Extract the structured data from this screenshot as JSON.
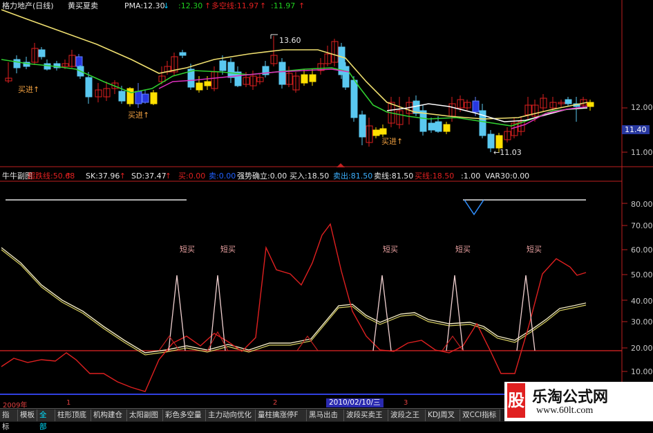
{
  "header": {
    "stock": "格力地产(日线)",
    "formula": "黄买夏卖",
    "pma": "PMA:12.30",
    "pma_arrow": "↓",
    "v2": ":12.30",
    "v2_arrow": "↑",
    "duokong": "多空线:11.97",
    "duokong_arrow": "↑",
    "v4": ":11.97",
    "v4_arrow": "↑"
  },
  "main": {
    "price_labels": [
      "12.00",
      "11.40",
      "11.00"
    ],
    "high_label": "13.60",
    "low_label": "←11.03",
    "buy_labels": [
      "买进",
      "买进",
      "买进"
    ]
  },
  "sub": {
    "title": "牛牛副图",
    "items": [
      {
        "text": "超跌线:50.68",
        "color": "#e02020",
        "arrow": "↑"
      },
      {
        "text": "SK:37.96",
        "color": "#e8e8e8",
        "arrow": "↑"
      },
      {
        "text": "SD:37.47",
        "color": "#e8e8e8",
        "arrow": "↑"
      },
      {
        "text": "买:0.00",
        "color": "#e02020",
        "arrow": ""
      },
      {
        "text": "卖:0.00",
        "color": "#2060ff",
        "arrow": ""
      },
      {
        "text": "强势确立:0.00",
        "color": "#e8e8e8",
        "arrow": ""
      },
      {
        "text": "买入:18.50",
        "color": "#e8e8e8",
        "arrow": ""
      },
      {
        "text": "卖出:81.50",
        "color": "#3cb0ff",
        "arrow": ""
      },
      {
        "text": "卖线:81.50",
        "color": "#e8e8e8",
        "arrow": ""
      },
      {
        "text": "买线:18.50",
        "color": "#e02020",
        "arrow": ""
      },
      {
        "text": ":1.00",
        "color": "#e8e8e8",
        "arrow": ""
      },
      {
        "text": "VAR30:0.00",
        "color": "#e8e8e8",
        "arrow": ""
      }
    ],
    "axis_labels": [
      "80.00",
      "70.00",
      "60.00",
      "50.00",
      "40.00",
      "30.00",
      "20.00",
      "10.00"
    ],
    "short_buy_labels": [
      "短买",
      "短买",
      "短买",
      "短买",
      "短买"
    ]
  },
  "datebar": {
    "labels": [
      "2009年",
      "1",
      "2",
      "3"
    ],
    "selected": "2010/02/10/三"
  },
  "tabs": [
    "指标",
    "模板",
    "全部",
    "柱形顶底",
    "机构建仓",
    "太阳副图",
    "彩色多空量",
    "主力动向优化",
    "量柱擒涨停F",
    "黑马出击",
    "波段买卖王",
    "波段之王",
    "KDJ周叉",
    "双CCI指标"
  ],
  "active_tab": 2,
  "watermark": {
    "logo": "股",
    "name": "乐淘公式网",
    "url": "www.60lt.com"
  },
  "colors": {
    "up_candle": "#e02020",
    "down_candle": "#5ac8f0",
    "yellow_block": "#ffe000",
    "blue_block": "#2838e0",
    "ma_yellow": "#f0e070",
    "ma_green": "#30d030",
    "ma_magenta": "#e030c0",
    "ma_white": "#ffffff",
    "ref_line": "#c02020"
  }
}
